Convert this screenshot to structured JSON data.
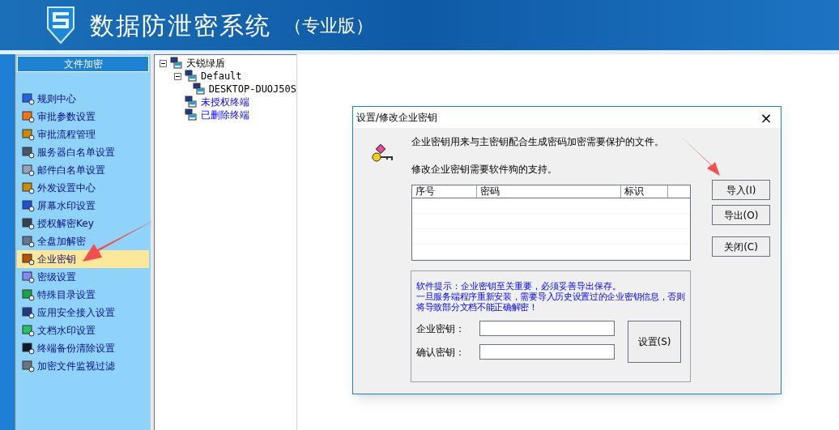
{
  "header": {
    "title": "数据防泄密系统",
    "edition": "（专业版）"
  },
  "sidebar": {
    "title": "文件加密",
    "items": [
      {
        "label": "规则中心",
        "selected": false
      },
      {
        "label": "审批参数设置",
        "selected": false
      },
      {
        "label": "审批流程管理",
        "selected": false
      },
      {
        "label": "服务器白名单设置",
        "selected": false
      },
      {
        "label": "邮件白名单设置",
        "selected": false
      },
      {
        "label": "外发设置中心",
        "selected": false
      },
      {
        "label": "屏幕水印设置",
        "selected": false
      },
      {
        "label": "授权解密Key",
        "selected": false
      },
      {
        "label": "全盘加解密",
        "selected": false
      },
      {
        "label": "企业密钥",
        "selected": true
      },
      {
        "label": "密级设置",
        "selected": false
      },
      {
        "label": "特殊目录设置",
        "selected": false
      },
      {
        "label": "应用安全接入设置",
        "selected": false
      },
      {
        "label": "文档水印设置",
        "selected": false
      },
      {
        "label": "终端备份清除设置",
        "selected": false
      },
      {
        "label": "加密文件监视过滤",
        "selected": false
      }
    ]
  },
  "tree": [
    {
      "label": "天锐绿盾",
      "expanded": true,
      "children": [
        {
          "label": "Default",
          "expanded": true,
          "children": [
            {
              "label": "DESKTOP-DUOJ50S"
            }
          ]
        },
        {
          "label": "未授权终端",
          "kind": "link"
        },
        {
          "label": "已删除终端",
          "kind": "link"
        }
      ]
    }
  ],
  "dialog": {
    "title": "设置/修改企业密钥",
    "close": "×",
    "lines": [
      "企业密钥用来与主密钥配合生成密码加密需要保护的文件。",
      "修改企业密钥需要软件狗的支持。"
    ],
    "table": {
      "columns": [
        "序号",
        "密码",
        "标识"
      ]
    },
    "buttons": [
      "导入(I)",
      "导出(O)",
      "关闭(C)"
    ],
    "hint": [
      "软件提示：企业密钥至关重要，必须妥善导出保存。",
      "一旦服务端程序重新安装，需要导入历史设置过的企业密钥信息，否则将导致部分文档不能正确解密！"
    ],
    "fields": [
      {
        "label": "企业密钥："
      },
      {
        "label": "确认密钥："
      }
    ],
    "set_button": "设置(S)"
  }
}
